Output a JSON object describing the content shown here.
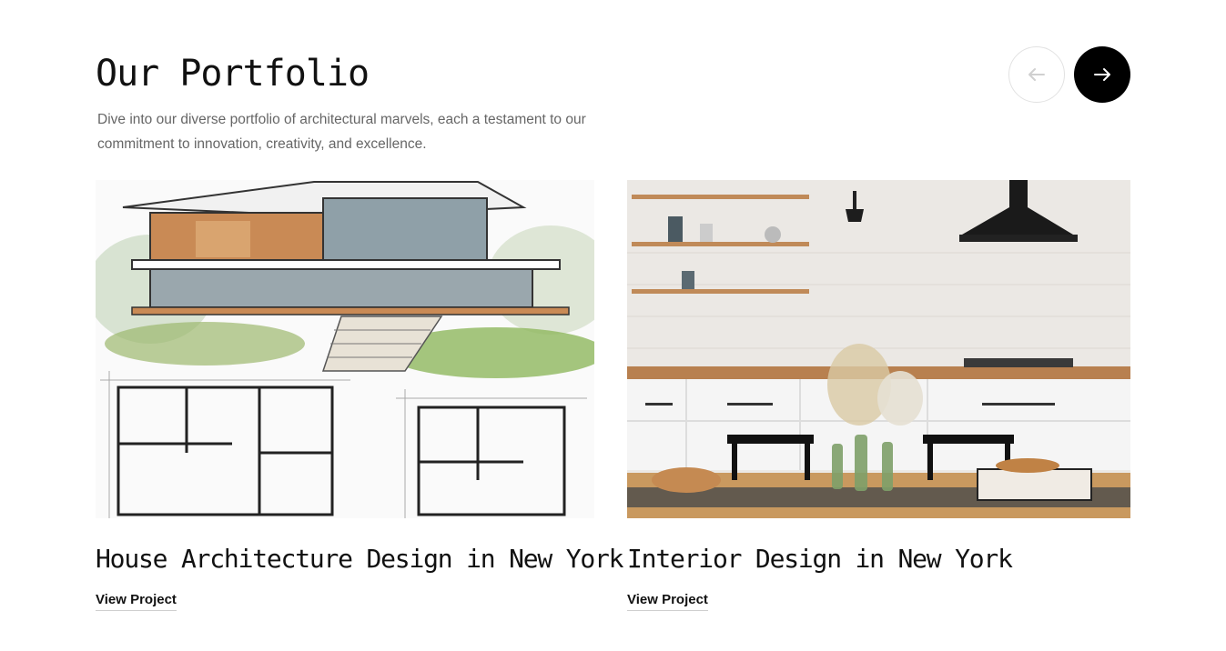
{
  "section": {
    "title": "Our Portfolio",
    "description": "Dive into our diverse portfolio of architectural marvels, each a testament to our commitment to innovation, creativity, and excellence."
  },
  "navigation": {
    "prev_icon": "arrow-left-icon",
    "next_icon": "arrow-right-icon"
  },
  "projects": [
    {
      "title": "House Architecture Design in New York",
      "link_label": "View Project",
      "image": "house-sketch-with-floor-plans"
    },
    {
      "title": "Interior Design in New York",
      "link_label": "View Project",
      "image": "kitchen-interior-photo"
    }
  ],
  "colors": {
    "accent": "#000000",
    "text": "#111111",
    "muted": "#666666"
  }
}
